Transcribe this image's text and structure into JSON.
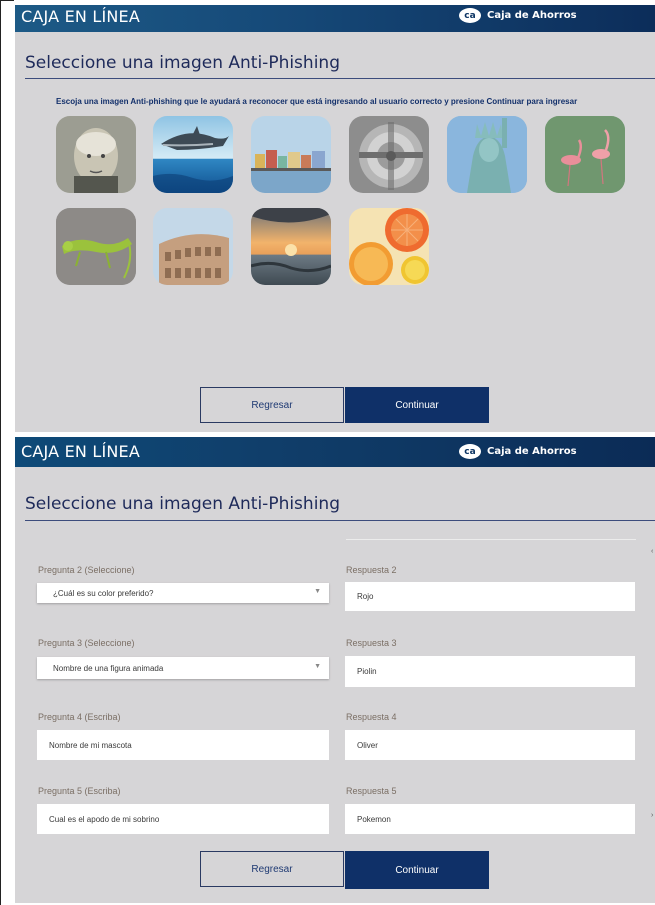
{
  "screen1": {
    "brand_title": "CAJA EN LÍNEA",
    "logo_mark": "ca",
    "logo_text": "Caja de Ahorros",
    "section_title": "Seleccione una imagen Anti-Phishing",
    "instruction": "Escoja una imagen Anti-phishing que le ayudará a reconocer que está ingresando al usuario correcto y presione Continuar para ingresar",
    "images": [
      "portrait-engraving-image",
      "dolphin-image",
      "harbor-houses-image",
      "bank-vault-image",
      "statue-of-liberty-image",
      "flamingos-image",
      "iguana-image",
      "colosseum-image",
      "sunset-sea-image",
      "citrus-slices-image"
    ],
    "back_label": "Regresar",
    "continue_label": "Continuar"
  },
  "screen2": {
    "brand_title": "CAJA EN LÍNEA",
    "logo_mark": "ca",
    "logo_text": "Caja de Ahorros",
    "section_title": "Seleccione una imagen Anti-Phishing",
    "questions": [
      {
        "question_label": "Pregunta 2 (Seleccione)",
        "question_value": "¿Cuál es su color preferido?",
        "answer_label": "Respuesta 2",
        "answer_value": "Rojo"
      },
      {
        "question_label": "Pregunta 3 (Seleccione)",
        "question_value": "Nombre de una figura animada",
        "answer_label": "Respuesta 3",
        "answer_value": "Piolin"
      },
      {
        "question_label": "Pregunta 4 (Escriba)",
        "question_value": "Nombre de mi mascota",
        "answer_label": "Respuesta 4",
        "answer_value": "Oliver"
      },
      {
        "question_label": "Pregunta 5 (Escriba)",
        "question_value": "Cual es el apodo de mi sobrino",
        "answer_label": "Respuesta 5",
        "answer_value": "Pokemon"
      }
    ],
    "back_label": "Regresar",
    "continue_label": "Continuar"
  },
  "colors": {
    "panel_bg": "#d6d5d7",
    "brand_bar": "#0e4a78",
    "primary_button": "#0f3068",
    "title_text": "#1e2a5a"
  }
}
